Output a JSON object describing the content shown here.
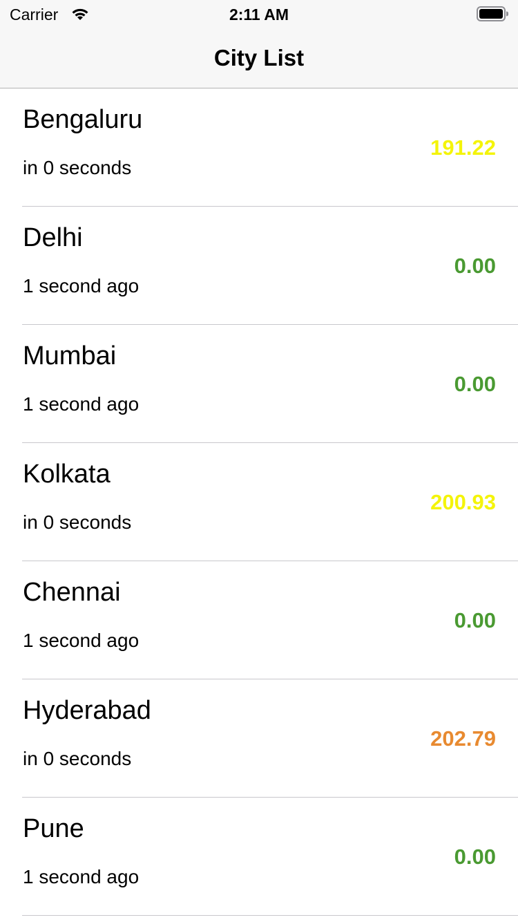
{
  "status_bar": {
    "carrier": "Carrier",
    "time": "2:11 AM",
    "wifi_icon": "wifi-icon",
    "battery_icon": "battery-icon"
  },
  "nav": {
    "title": "City List"
  },
  "cities": [
    {
      "name": "Bengaluru",
      "updated": "in 0 seconds",
      "aqi": "191.22",
      "color": "#f4f40a"
    },
    {
      "name": "Delhi",
      "updated": "1 second ago",
      "aqi": "0.00",
      "color": "#4a9a32"
    },
    {
      "name": "Mumbai",
      "updated": "1 second ago",
      "aqi": "0.00",
      "color": "#4a9a32"
    },
    {
      "name": "Kolkata",
      "updated": "in 0 seconds",
      "aqi": "200.93",
      "color": "#f4f40a"
    },
    {
      "name": "Chennai",
      "updated": "1 second ago",
      "aqi": "0.00",
      "color": "#4a9a32"
    },
    {
      "name": "Hyderabad",
      "updated": "in 0 seconds",
      "aqi": "202.79",
      "color": "#e88a30"
    },
    {
      "name": "Pune",
      "updated": "1 second ago",
      "aqi": "0.00",
      "color": "#4a9a32"
    }
  ]
}
